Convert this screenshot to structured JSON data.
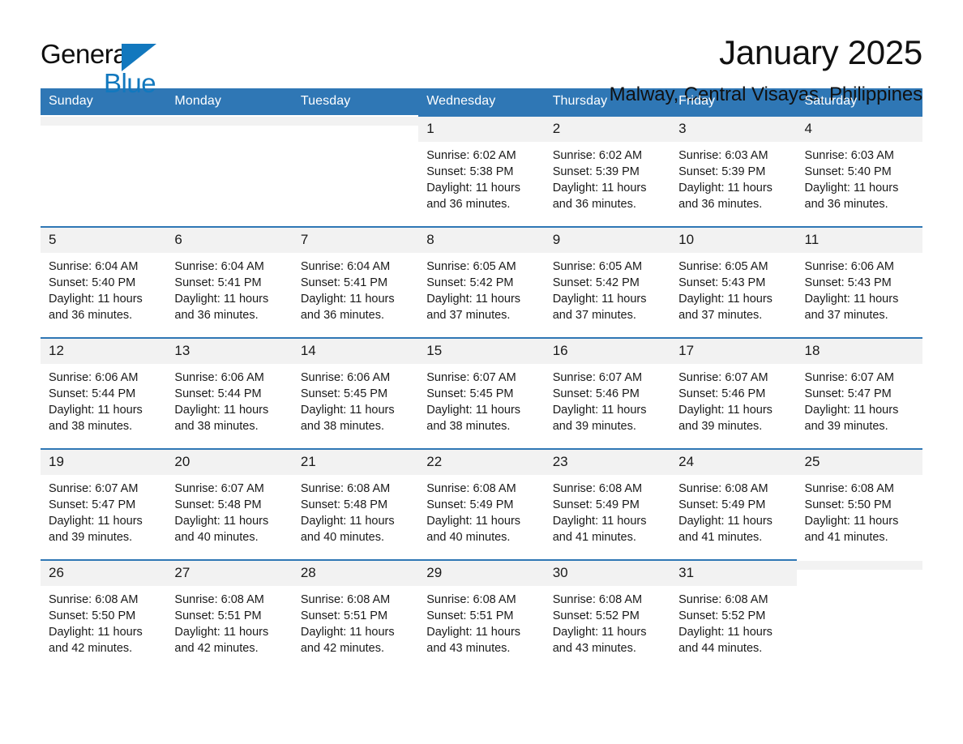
{
  "brand": {
    "name_part1": "General",
    "name_part2": "Blue",
    "accent_color": "#1278be"
  },
  "header": {
    "title": "January 2025",
    "subtitle": "Malway, Central Visayas, Philippines",
    "header_bar_color": "#2f77b5",
    "daynum_bg_color": "#f2f2f2"
  },
  "weekday_headers": [
    "Sunday",
    "Monday",
    "Tuesday",
    "Wednesday",
    "Thursday",
    "Friday",
    "Saturday"
  ],
  "weeks": [
    [
      {
        "day": "",
        "empty": true
      },
      {
        "day": "",
        "empty": true
      },
      {
        "day": "",
        "empty": true
      },
      {
        "day": "1",
        "sunrise": "Sunrise: 6:02 AM",
        "sunset": "Sunset: 5:38 PM",
        "daylight": "Daylight: 11 hours and 36 minutes."
      },
      {
        "day": "2",
        "sunrise": "Sunrise: 6:02 AM",
        "sunset": "Sunset: 5:39 PM",
        "daylight": "Daylight: 11 hours and 36 minutes."
      },
      {
        "day": "3",
        "sunrise": "Sunrise: 6:03 AM",
        "sunset": "Sunset: 5:39 PM",
        "daylight": "Daylight: 11 hours and 36 minutes."
      },
      {
        "day": "4",
        "sunrise": "Sunrise: 6:03 AM",
        "sunset": "Sunset: 5:40 PM",
        "daylight": "Daylight: 11 hours and 36 minutes."
      }
    ],
    [
      {
        "day": "5",
        "sunrise": "Sunrise: 6:04 AM",
        "sunset": "Sunset: 5:40 PM",
        "daylight": "Daylight: 11 hours and 36 minutes."
      },
      {
        "day": "6",
        "sunrise": "Sunrise: 6:04 AM",
        "sunset": "Sunset: 5:41 PM",
        "daylight": "Daylight: 11 hours and 36 minutes."
      },
      {
        "day": "7",
        "sunrise": "Sunrise: 6:04 AM",
        "sunset": "Sunset: 5:41 PM",
        "daylight": "Daylight: 11 hours and 36 minutes."
      },
      {
        "day": "8",
        "sunrise": "Sunrise: 6:05 AM",
        "sunset": "Sunset: 5:42 PM",
        "daylight": "Daylight: 11 hours and 37 minutes."
      },
      {
        "day": "9",
        "sunrise": "Sunrise: 6:05 AM",
        "sunset": "Sunset: 5:42 PM",
        "daylight": "Daylight: 11 hours and 37 minutes."
      },
      {
        "day": "10",
        "sunrise": "Sunrise: 6:05 AM",
        "sunset": "Sunset: 5:43 PM",
        "daylight": "Daylight: 11 hours and 37 minutes."
      },
      {
        "day": "11",
        "sunrise": "Sunrise: 6:06 AM",
        "sunset": "Sunset: 5:43 PM",
        "daylight": "Daylight: 11 hours and 37 minutes."
      }
    ],
    [
      {
        "day": "12",
        "sunrise": "Sunrise: 6:06 AM",
        "sunset": "Sunset: 5:44 PM",
        "daylight": "Daylight: 11 hours and 38 minutes."
      },
      {
        "day": "13",
        "sunrise": "Sunrise: 6:06 AM",
        "sunset": "Sunset: 5:44 PM",
        "daylight": "Daylight: 11 hours and 38 minutes."
      },
      {
        "day": "14",
        "sunrise": "Sunrise: 6:06 AM",
        "sunset": "Sunset: 5:45 PM",
        "daylight": "Daylight: 11 hours and 38 minutes."
      },
      {
        "day": "15",
        "sunrise": "Sunrise: 6:07 AM",
        "sunset": "Sunset: 5:45 PM",
        "daylight": "Daylight: 11 hours and 38 minutes."
      },
      {
        "day": "16",
        "sunrise": "Sunrise: 6:07 AM",
        "sunset": "Sunset: 5:46 PM",
        "daylight": "Daylight: 11 hours and 39 minutes."
      },
      {
        "day": "17",
        "sunrise": "Sunrise: 6:07 AM",
        "sunset": "Sunset: 5:46 PM",
        "daylight": "Daylight: 11 hours and 39 minutes."
      },
      {
        "day": "18",
        "sunrise": "Sunrise: 6:07 AM",
        "sunset": "Sunset: 5:47 PM",
        "daylight": "Daylight: 11 hours and 39 minutes."
      }
    ],
    [
      {
        "day": "19",
        "sunrise": "Sunrise: 6:07 AM",
        "sunset": "Sunset: 5:47 PM",
        "daylight": "Daylight: 11 hours and 39 minutes."
      },
      {
        "day": "20",
        "sunrise": "Sunrise: 6:07 AM",
        "sunset": "Sunset: 5:48 PM",
        "daylight": "Daylight: 11 hours and 40 minutes."
      },
      {
        "day": "21",
        "sunrise": "Sunrise: 6:08 AM",
        "sunset": "Sunset: 5:48 PM",
        "daylight": "Daylight: 11 hours and 40 minutes."
      },
      {
        "day": "22",
        "sunrise": "Sunrise: 6:08 AM",
        "sunset": "Sunset: 5:49 PM",
        "daylight": "Daylight: 11 hours and 40 minutes."
      },
      {
        "day": "23",
        "sunrise": "Sunrise: 6:08 AM",
        "sunset": "Sunset: 5:49 PM",
        "daylight": "Daylight: 11 hours and 41 minutes."
      },
      {
        "day": "24",
        "sunrise": "Sunrise: 6:08 AM",
        "sunset": "Sunset: 5:49 PM",
        "daylight": "Daylight: 11 hours and 41 minutes."
      },
      {
        "day": "25",
        "sunrise": "Sunrise: 6:08 AM",
        "sunset": "Sunset: 5:50 PM",
        "daylight": "Daylight: 11 hours and 41 minutes."
      }
    ],
    [
      {
        "day": "26",
        "sunrise": "Sunrise: 6:08 AM",
        "sunset": "Sunset: 5:50 PM",
        "daylight": "Daylight: 11 hours and 42 minutes."
      },
      {
        "day": "27",
        "sunrise": "Sunrise: 6:08 AM",
        "sunset": "Sunset: 5:51 PM",
        "daylight": "Daylight: 11 hours and 42 minutes."
      },
      {
        "day": "28",
        "sunrise": "Sunrise: 6:08 AM",
        "sunset": "Sunset: 5:51 PM",
        "daylight": "Daylight: 11 hours and 42 minutes."
      },
      {
        "day": "29",
        "sunrise": "Sunrise: 6:08 AM",
        "sunset": "Sunset: 5:51 PM",
        "daylight": "Daylight: 11 hours and 43 minutes."
      },
      {
        "day": "30",
        "sunrise": "Sunrise: 6:08 AM",
        "sunset": "Sunset: 5:52 PM",
        "daylight": "Daylight: 11 hours and 43 minutes."
      },
      {
        "day": "31",
        "sunrise": "Sunrise: 6:08 AM",
        "sunset": "Sunset: 5:52 PM",
        "daylight": "Daylight: 11 hours and 44 minutes."
      },
      {
        "day": "",
        "empty": true
      }
    ]
  ]
}
